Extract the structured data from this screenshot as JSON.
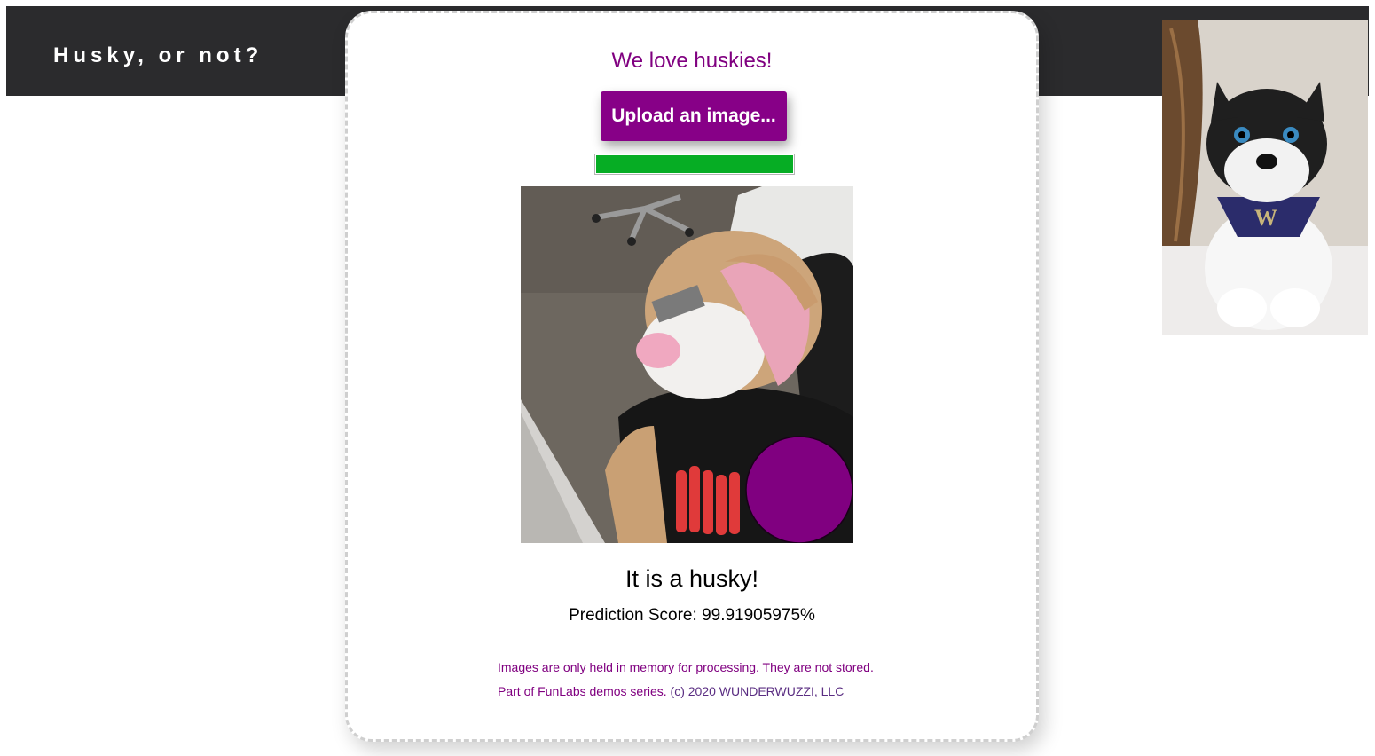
{
  "header": {
    "title": "Husky, or not?"
  },
  "card": {
    "tagline": "We love huskies!",
    "upload_label": "Upload an image...",
    "progress_fraction": 1.0,
    "result_text": "It is a husky!",
    "score_label": "Prediction Score:",
    "score_value": "99.91905975%",
    "notice": "Images are only held in memory for processing. They are not stored.",
    "credits_prefix": "Part of FunLabs demos series.",
    "credits_link": "(c) 2020 WUNDERWUZZI, LLC"
  },
  "colors": {
    "accent": "#800080",
    "button": "#870087",
    "progress": "#06ad24",
    "header_bg": "#2b2b2d"
  },
  "images": {
    "uploaded_photo": "plush-toy-photo",
    "mascot_photo": "husky-plush-mascot"
  }
}
